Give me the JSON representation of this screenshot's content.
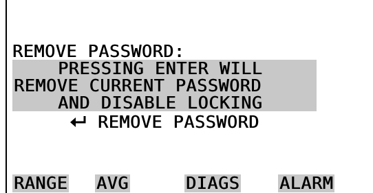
{
  "screen": {
    "title": "REMOVE PASSWORD:",
    "message_lines": [
      "PRESSING ENTER WILL",
      "REMOVE CURRENT PASSWORD",
      "AND DISABLE LOCKING"
    ],
    "action": {
      "icon": "enter-arrow-icon",
      "label": "REMOVE PASSWORD"
    }
  },
  "softkeys": [
    {
      "label": "RANGE"
    },
    {
      "label": "AVG"
    },
    {
      "label": "DIAGS"
    },
    {
      "label": "ALARM"
    }
  ],
  "colors": {
    "highlight": "#c8c8c8",
    "text": "#000000",
    "background": "#ffffff"
  }
}
